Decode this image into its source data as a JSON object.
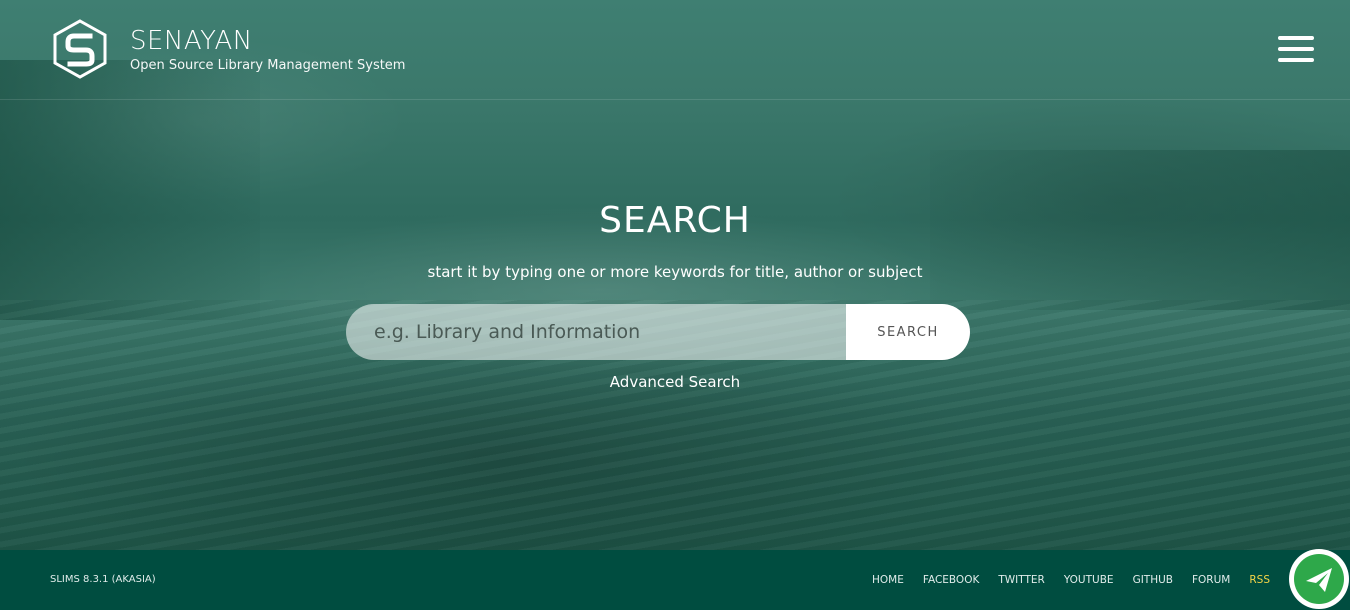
{
  "header": {
    "brand_title": "SENAYAN",
    "brand_subtitle": "Open Source Library Management System",
    "logo_icon": "slims-hexagon-logo-icon",
    "menu_icon": "hamburger-menu-icon"
  },
  "search": {
    "title": "SEARCH",
    "hint": "start it by typing one or more keywords for title, author or subject",
    "placeholder": "e.g. Library and Information",
    "value": "",
    "button_label": "SEARCH",
    "advanced_label": "Advanced Search"
  },
  "footer": {
    "version": "SLIMS 8.3.1 (AKASIA)",
    "links": [
      "HOME",
      "FACEBOOK",
      "TWITTER",
      "YOUTUBE",
      "GITHUB",
      "FORUM",
      "RSS"
    ],
    "rss_color": "#f5d547",
    "fab_icon": "paper-plane-icon"
  },
  "colors": {
    "hero_tint": "#3b786b",
    "footer_bg": "#004d40",
    "fab_green": "#2ea84a"
  }
}
